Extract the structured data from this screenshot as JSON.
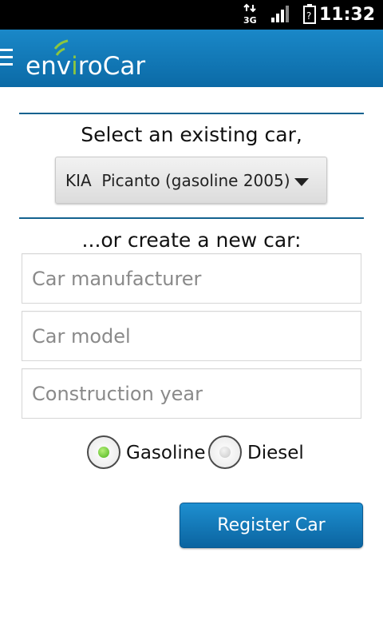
{
  "status_bar": {
    "time": "11:32",
    "icons": [
      "data-arrows-3g-icon",
      "signal-bars-icon",
      "battery-unknown-icon"
    ],
    "network_label": "3G",
    "battery_label": "?"
  },
  "action_bar": {
    "menu_icon": "hamburger-menu-icon",
    "logo_prefix": "env",
    "logo_accent": "i",
    "logo_suffix": "roCar",
    "colors": {
      "background": "#1178b8",
      "logo_accent": "#8cc63f"
    }
  },
  "form": {
    "select_heading": "Select an existing car,",
    "selected_car": "KIA  Picanto (gasoline 2005)",
    "create_heading": "...or create a new car:",
    "manufacturer_placeholder": "Car manufacturer",
    "model_placeholder": "Car model",
    "year_placeholder": "Construction year",
    "fuel_options": [
      {
        "label": "Gasoline",
        "selected": true
      },
      {
        "label": "Diesel",
        "selected": false
      }
    ],
    "register_label": "Register Car",
    "colors": {
      "divider": "#13628f",
      "radio_selected": "#5dc02a",
      "button": "#1177bb"
    }
  }
}
